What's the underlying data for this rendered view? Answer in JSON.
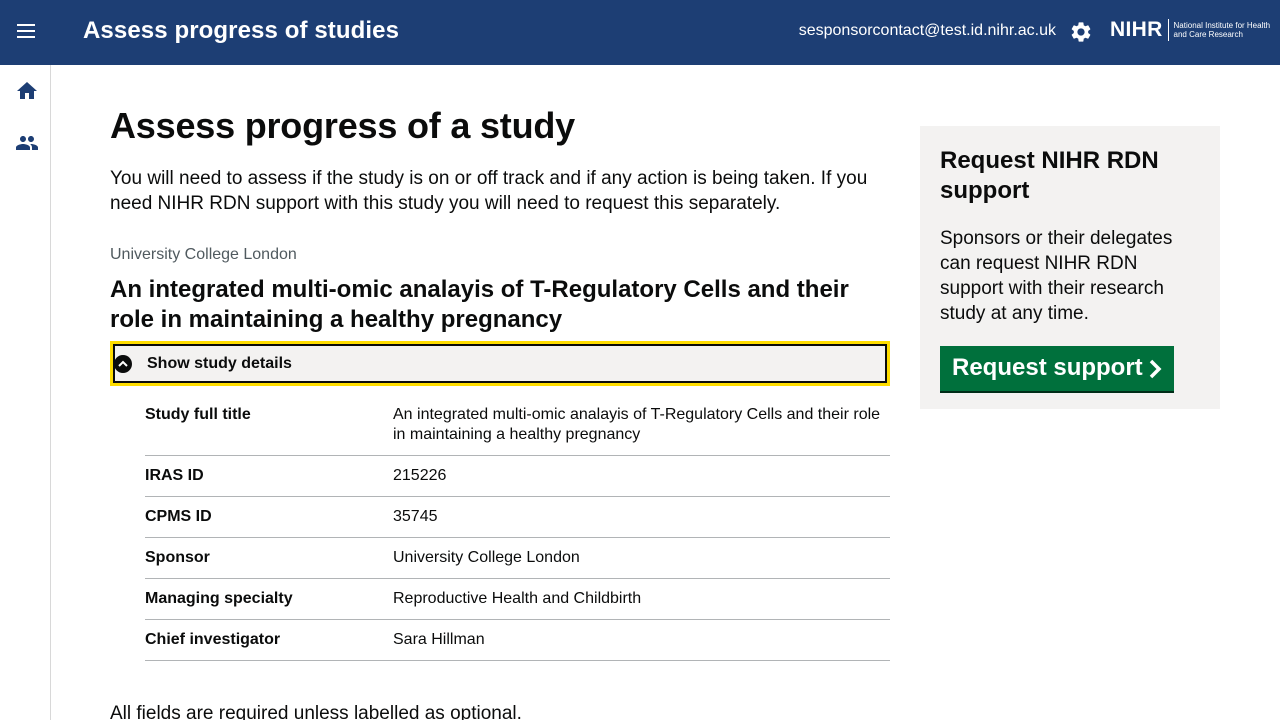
{
  "header": {
    "app_title": "Assess progress of studies",
    "user_email": "sesponsorcontact@test.id.nihr.ac.uk",
    "logo_mark": "NIHR",
    "logo_subtitle": "National Institute for Health and Care Research",
    "icons": [
      "menu-icon",
      "gear-icon"
    ],
    "color": "#1d3e74"
  },
  "sidebar": {
    "items": [
      {
        "icon": "home-icon"
      },
      {
        "icon": "people-icon"
      }
    ]
  },
  "main": {
    "page_title": "Assess progress of a study",
    "intro": "You will need to assess if the study is on or off track and if any action is being taken. If you need NIHR RDN support with this study you will need to request this separately.",
    "organisation": "University College London",
    "study_title": "An integrated multi-omic analayis of T-Regulatory Cells and their role in maintaining a healthy pregnancy",
    "details_toggle_label": "Show study details",
    "summary": [
      {
        "key": "Study full title",
        "value": "An integrated multi-omic analayis of T-Regulatory Cells and their role in maintaining a healthy pregnancy"
      },
      {
        "key": "IRAS ID",
        "value": "215226"
      },
      {
        "key": "CPMS ID",
        "value": "35745"
      },
      {
        "key": "Sponsor",
        "value": "University College London"
      },
      {
        "key": "Managing specialty",
        "value": "Reproductive Health and Childbirth"
      },
      {
        "key": "Chief investigator",
        "value": "Sara Hillman"
      }
    ],
    "required_note": "All fields are required unless labelled as optional."
  },
  "aside": {
    "title": "Request NIHR RDN support",
    "body": "Sponsors or their delegates can request NIHR RDN support with their research study at any time.",
    "button_label": "Request support",
    "button_color": "#00703c"
  }
}
